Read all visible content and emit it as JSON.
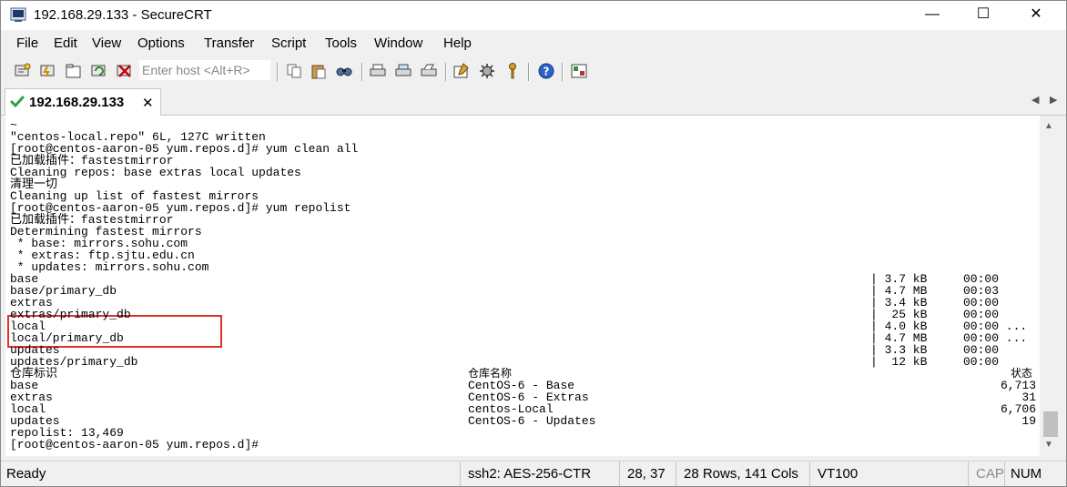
{
  "window": {
    "title": "192.168.29.133 - SecureCRT",
    "controls": {
      "minimize": "—",
      "maximize": "☐",
      "close": "✕"
    }
  },
  "menu": [
    "File",
    "Edit",
    "View",
    "Options",
    "Transfer",
    "Script",
    "Tools",
    "Window",
    "Help"
  ],
  "toolbar": {
    "host_placeholder": "Enter host <Alt+R>",
    "icons": [
      "connect-icon",
      "quick-connect-icon",
      "connect-tab-icon",
      "reconnect-icon",
      "disconnect-icon",
      "copy-icon",
      "paste-icon",
      "find-icon",
      "print-icon",
      "print-selection-icon",
      "print-setup-icon",
      "session-options-icon",
      "global-options-icon",
      "keymap-icon",
      "help-icon",
      "sftp-icon"
    ]
  },
  "tab": {
    "label": "192.168.29.133",
    "close": "✕"
  },
  "terminal": {
    "lines": [
      "~",
      "\"centos-local.repo\" 6L, 127C written",
      "[root@centos-aaron-05 yum.repos.d]# yum clean all",
      "已加载插件：fastestmirror",
      "Cleaning repos: base extras local updates",
      "清理一切",
      "Cleaning up list of fastest mirrors",
      "[root@centos-aaron-05 yum.repos.d]# yum repolist",
      "已加载插件：fastestmirror",
      "Determining fastest mirrors",
      " * base: mirrors.sohu.com",
      " * extras: ftp.sjtu.edu.cn",
      " * updates: mirrors.sohu.com",
      "base",
      "base/primary_db",
      "extras",
      "extras/primary_db",
      "local",
      "local/primary_db",
      "updates",
      "updates/primary_db",
      "仓库标识",
      "base",
      "extras",
      "local",
      "updates",
      "repolist: 13,469",
      "[root@centos-aaron-05 yum.repos.d]#"
    ],
    "download_rows": [
      {
        "size": "| 3.7 kB",
        "time": "00:00"
      },
      {
        "size": "| 4.7 MB",
        "time": "00:03"
      },
      {
        "size": "| 3.4 kB",
        "time": "00:00"
      },
      {
        "size": "|  25 kB",
        "time": "00:00"
      },
      {
        "size": "| 4.0 kB",
        "time": "00:00 ..."
      },
      {
        "size": "| 4.7 MB",
        "time": "00:00 ..."
      },
      {
        "size": "| 3.3 kB",
        "time": "00:00"
      },
      {
        "size": "|  12 kB",
        "time": "00:00"
      }
    ],
    "repo_names_header": "仓库名称",
    "repo_names": [
      "CentOS-6 - Base",
      "CentOS-6 - Extras",
      "centos-Local",
      "CentOS-6 - Updates"
    ],
    "status_header": "状态",
    "status_values": [
      "6,713",
      "31",
      "6,706",
      "19"
    ]
  },
  "statusbar": {
    "ready": "Ready",
    "cipher": "ssh2: AES-256-CTR",
    "cursor": "28,  37",
    "size": "28 Rows, 141 Cols",
    "term": "VT100",
    "cap": "CAP",
    "num": "NUM"
  },
  "colors": {
    "highlight_box": "#e0302e",
    "tab_check": "#2ea043"
  }
}
